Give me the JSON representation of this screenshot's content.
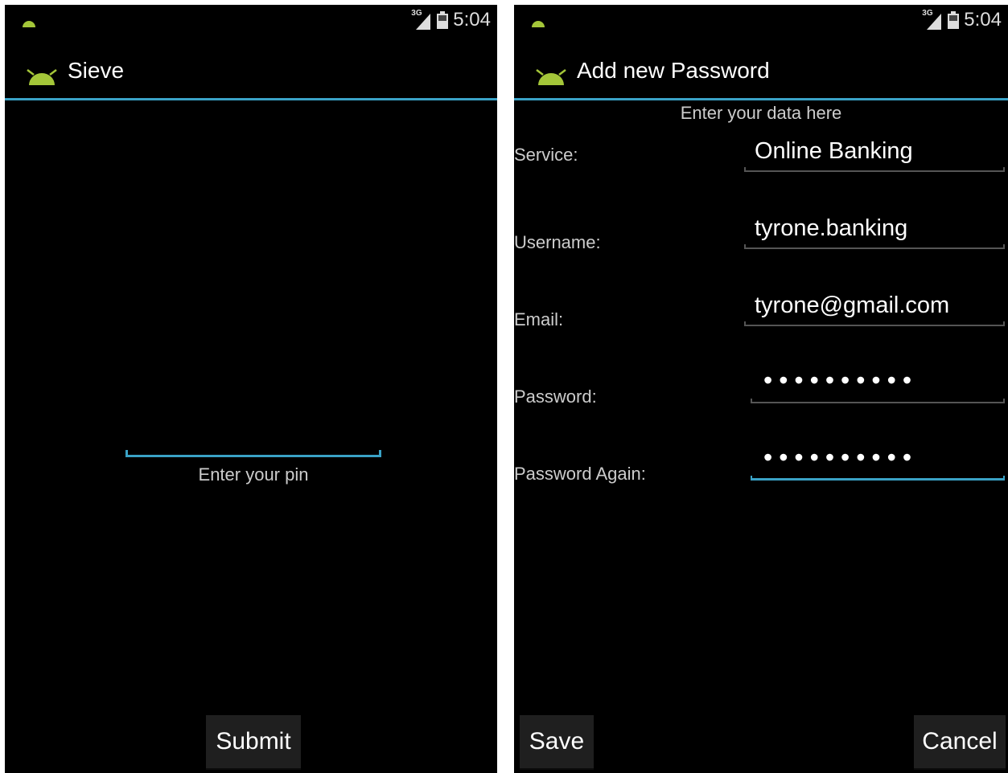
{
  "left_screen": {
    "status": {
      "network": "3G",
      "time": "5:04"
    },
    "title": "Sieve",
    "pin_hint": "Enter your pin",
    "submit_label": "Submit"
  },
  "right_screen": {
    "status": {
      "network": "3G",
      "time": "5:04"
    },
    "title": "Add new Password",
    "heading": "Enter your data here",
    "fields": [
      {
        "label": "Service:",
        "value": "Online Banking"
      },
      {
        "label": "Username:",
        "value": "tyrone.banking"
      },
      {
        "label": "Email:",
        "value": "tyrone@gmail.com"
      },
      {
        "label": "Password:",
        "value": "••••••••••"
      },
      {
        "label": "Password Again:",
        "value": "••••••••••"
      }
    ],
    "save_label": "Save",
    "cancel_label": "Cancel"
  },
  "colors": {
    "accent": "#3aa2c6",
    "android_green": "#a4c639",
    "background": "#000000"
  },
  "icons": {
    "app": "android-app-icon",
    "signal": "signal-icon",
    "battery": "battery-icon"
  }
}
